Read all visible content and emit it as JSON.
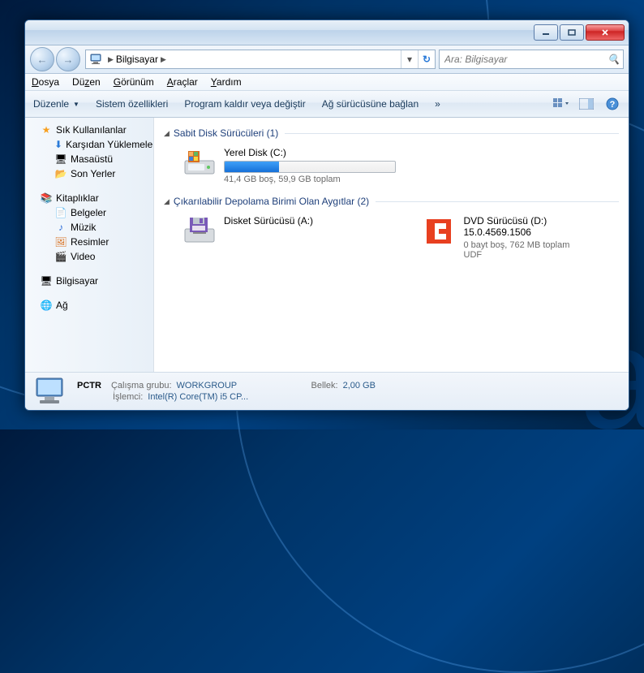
{
  "breadcrumb": {
    "root": "Bilgisayar"
  },
  "search": {
    "placeholder": "Ara: Bilgisayar"
  },
  "menus": {
    "file": "Dosya",
    "edit": "Düzen",
    "view": "Görünüm",
    "tools": "Araçlar",
    "help": "Yardım"
  },
  "toolbar": {
    "organize": "Düzenle",
    "sysprops": "Sistem özellikleri",
    "uninstall": "Program kaldır veya değiştir",
    "mapdrive": "Ağ sürücüsüne bağlan"
  },
  "sidebar": {
    "fav": {
      "head": "Sık Kullanılanlar",
      "items": [
        "Karşıdan Yüklemeler",
        "Masaüstü",
        "Son Yerler"
      ]
    },
    "lib": {
      "head": "Kitaplıklar",
      "items": [
        "Belgeler",
        "Müzik",
        "Resimler",
        "Video"
      ]
    },
    "computer": "Bilgisayar",
    "network": "Ağ"
  },
  "sections": {
    "hdd": {
      "title": "Sabit Disk Sürücüleri (1)"
    },
    "removable": {
      "title": "Çıkarılabilir Depolama Birimi Olan Aygıtlar (2)"
    }
  },
  "drives": {
    "c": {
      "name": "Yerel Disk (C:)",
      "info": "41,4 GB boş, 59,9 GB toplam",
      "fill_pct": 32
    },
    "a": {
      "name": "Disket Sürücüsü (A:)"
    },
    "d": {
      "name": "DVD Sürücüsü (D:) 15.0.4569.1506",
      "info": "0 bayt boş, 762 MB toplam",
      "fs": "UDF"
    }
  },
  "status": {
    "name": "PCTR",
    "wglabel": "Çalışma grubu:",
    "wg": "WORKGROUP",
    "memlabel": "Bellek:",
    "mem": "2,00 GB",
    "cpulabel": "İşlemci:",
    "cpu": "Intel(R) Core(TM) i5 CP..."
  }
}
